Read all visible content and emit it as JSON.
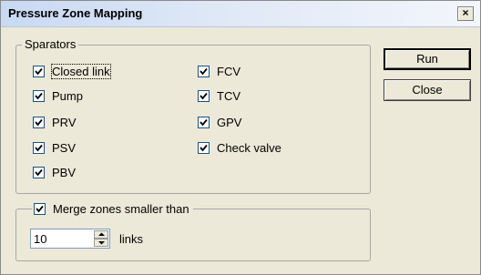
{
  "window": {
    "title": "Pressure Zone Mapping",
    "close_glyph": "×"
  },
  "separators": {
    "label": "Sparators",
    "left": [
      {
        "label": "Closed link",
        "checked": true
      },
      {
        "label": "Pump",
        "checked": true
      },
      {
        "label": "PRV",
        "checked": true
      },
      {
        "label": "PSV",
        "checked": true
      },
      {
        "label": "PBV",
        "checked": true
      }
    ],
    "right": [
      {
        "label": "FCV",
        "checked": true
      },
      {
        "label": "TCV",
        "checked": true
      },
      {
        "label": "GPV",
        "checked": true
      },
      {
        "label": "Check valve",
        "checked": true
      }
    ]
  },
  "merge": {
    "label": "Merge zones smaller than",
    "checked": true,
    "value": "10",
    "unit": "links"
  },
  "buttons": {
    "run": "Run",
    "close": "Close"
  },
  "icons": {
    "check": "check-mark-icon",
    "spin_up": "arrow-up-icon",
    "spin_down": "arrow-down-icon"
  }
}
